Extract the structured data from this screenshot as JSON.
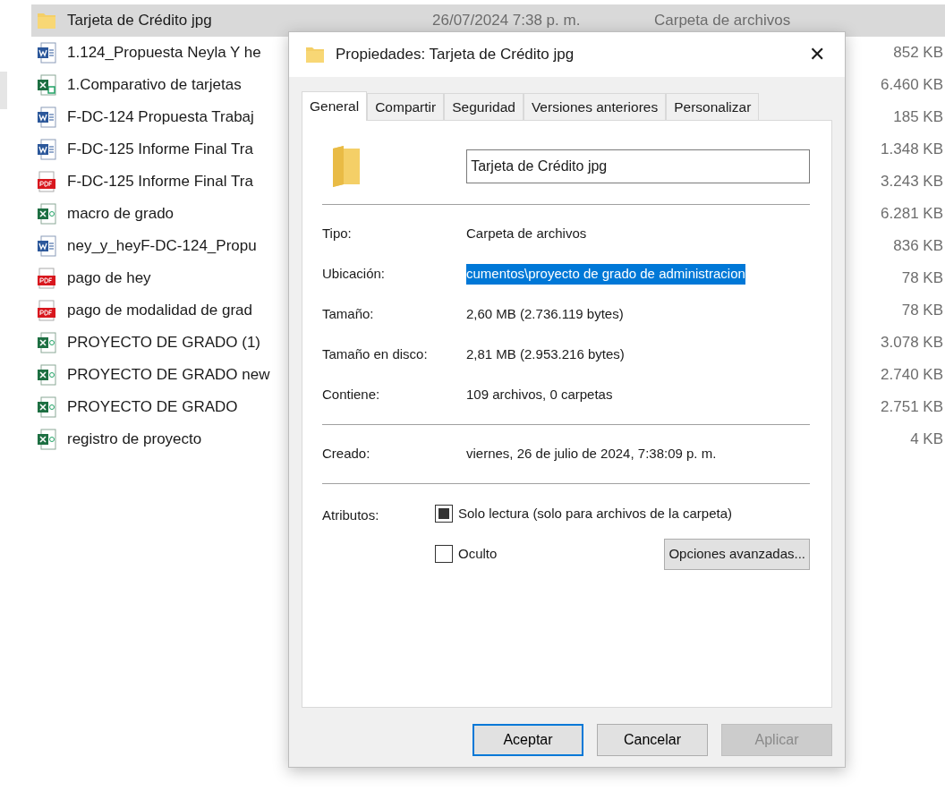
{
  "explorer": {
    "rows": [
      {
        "kind": "folder",
        "name": "Tarjeta de Crédito jpg",
        "date": "26/07/2024 7:38 p. m.",
        "type": "Carpeta de archivos",
        "selected": true
      },
      {
        "kind": "word",
        "name": "1.124_Propuesta Neyla Y he",
        "size": "852 KB",
        "selected": false
      },
      {
        "kind": "excel-shared",
        "name": "1.Comparativo de tarjetas",
        "size": "6.460 KB",
        "selected": false
      },
      {
        "kind": "word",
        "name": "F-DC-124 Propuesta Trabaj",
        "size": "185 KB",
        "selected": false
      },
      {
        "kind": "word",
        "name": "F-DC-125  Informe Final Tra",
        "size": "1.348 KB",
        "selected": false
      },
      {
        "kind": "pdf",
        "name": "F-DC-125  Informe Final Tra",
        "size": "3.243 KB",
        "selected": false
      },
      {
        "kind": "excel",
        "name": "macro de grado",
        "size": "6.281 KB",
        "selected": false
      },
      {
        "kind": "word",
        "name": "ney_y_heyF-DC-124_Propu",
        "size": "836 KB",
        "selected": false
      },
      {
        "kind": "pdf",
        "name": "pago de hey",
        "size": "78 KB",
        "selected": false
      },
      {
        "kind": "pdf",
        "name": "pago de modalidad de grad",
        "size": "78 KB",
        "selected": false
      },
      {
        "kind": "excel",
        "name": "PROYECTO DE GRADO (1)",
        "size": "3.078 KB",
        "selected": false
      },
      {
        "kind": "excel",
        "name": "PROYECTO DE GRADO new",
        "size": "2.740 KB",
        "selected": false
      },
      {
        "kind": "excel",
        "name": "PROYECTO DE GRADO",
        "size": "2.751 KB",
        "selected": false
      },
      {
        "kind": "excel",
        "name": "registro de proyecto",
        "size": "4 KB",
        "selected": false
      }
    ]
  },
  "dialog": {
    "title": "Propiedades: Tarjeta de Crédito jpg",
    "close": "✕",
    "tabs": [
      {
        "label": "General",
        "selected": true
      },
      {
        "label": "Compartir",
        "selected": false
      },
      {
        "label": "Seguridad",
        "selected": false
      },
      {
        "label": "Versiones anteriores",
        "selected": false
      },
      {
        "label": "Personalizar",
        "selected": false
      }
    ],
    "name_field": {
      "value": "Tarjeta de Crédito jpg"
    },
    "groups": [
      [
        {
          "label": "Tipo:",
          "value": "Carpeta de archivos",
          "highlighted": false
        },
        {
          "label": "Ubicación:",
          "value": "cumentos\\proyecto  de grado de administracion",
          "highlighted": true
        },
        {
          "label": "Tamaño:",
          "value": "2,60 MB (2.736.119 bytes)",
          "highlighted": false
        },
        {
          "label": "Tamaño en disco:",
          "value": "2,81 MB (2.953.216 bytes)",
          "highlighted": false
        },
        {
          "label": "Contiene:",
          "value": "109 archivos, 0 carpetas",
          "highlighted": false
        }
      ],
      [
        {
          "label": "Creado:",
          "value": "viernes, 26 de julio de 2024, 7:38:09 p. m.",
          "highlighted": false
        }
      ]
    ],
    "attributes": {
      "label": "Atributos:",
      "items": [
        {
          "label": "Solo lectura (solo para archivos de la carpeta)",
          "checked": false,
          "mixed": true
        },
        {
          "label": "Oculto",
          "checked": false,
          "mixed": false
        }
      ],
      "advanced": "Opciones avanzadas..."
    },
    "buttons": [
      {
        "label": "Aceptar",
        "default": true,
        "disabled": false
      },
      {
        "label": "Cancelar",
        "default": false,
        "disabled": false
      },
      {
        "label": "Aplicar",
        "default": false,
        "disabled": true
      }
    ]
  }
}
